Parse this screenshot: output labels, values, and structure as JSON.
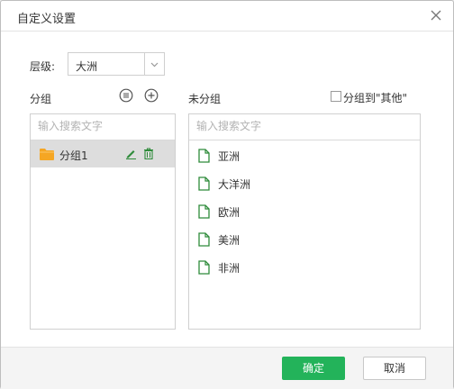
{
  "dialog": {
    "title": "自定义设置"
  },
  "level": {
    "label": "层级:",
    "value": "大洲"
  },
  "grouped": {
    "label": "分组",
    "search_placeholder": "输入搜索文字",
    "groups": [
      {
        "name": "分组1"
      }
    ]
  },
  "ungrouped": {
    "label": "未分组",
    "other_checkbox_label": "分组到\"其他\"",
    "search_placeholder": "输入搜索文字",
    "items": [
      {
        "name": "亚洲"
      },
      {
        "name": "大洋洲"
      },
      {
        "name": "欧洲"
      },
      {
        "name": "美洲"
      },
      {
        "name": "非洲"
      }
    ]
  },
  "footer": {
    "ok_label": "确定",
    "cancel_label": "取消"
  },
  "colors": {
    "accent": "#23b35a",
    "folder": "#f5a623",
    "doc": "#2e8b3a"
  }
}
